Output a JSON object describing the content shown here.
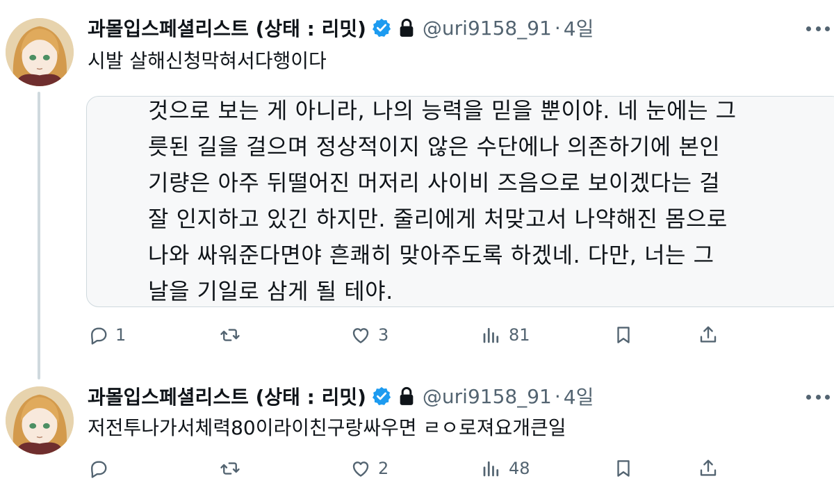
{
  "tweets": [
    {
      "author": {
        "display_name": "과몰입스페셜리스트 (상태 : 리밋)",
        "handle": "@uri9158_91",
        "time": "4일",
        "verified": true,
        "protected": true
      },
      "text": "시발 살해신청막혀서다행이다",
      "quote_lines": [
        "것으로 보는 게 아니라, 나의 능력을 믿을 뿐이야. 네 눈에는 그",
        "릇된 길을 걸으며 정상적이지 않은 수단에나 의존하기에 본인",
        "기량은 아주 뒤떨어진 머저리 사이비 즈음으로 보이겠다는 걸",
        "잘 인지하고 있긴 하지만. 줄리에게 처맞고서 나약해진 몸으로",
        "나와 싸워준다면야 흔쾌히 맞아주도록 하겠네. 다만, 너는 그",
        "날을 기일로 삼게 될 테야."
      ],
      "actions": {
        "reply_count": "1",
        "retweet_count": "",
        "like_count": "3",
        "view_count": "81"
      }
    },
    {
      "author": {
        "display_name": "과몰입스페셜리스트 (상태 : 리밋)",
        "handle": "@uri9158_91",
        "time": "4일",
        "verified": true,
        "protected": true
      },
      "text": "저전투나가서체력80이라이친구랑싸우면 ㄹㅇ로져요개큰일",
      "actions": {
        "reply_count": "",
        "retweet_count": "",
        "like_count": "2",
        "view_count": "48"
      }
    }
  ],
  "icons": {
    "verified": "verified-badge-icon",
    "protected": "lock-icon",
    "more": "more-icon",
    "reply": "reply-icon",
    "retweet": "retweet-icon",
    "like": "like-icon",
    "views": "views-icon",
    "bookmark": "bookmark-icon",
    "share": "share-icon"
  },
  "colors": {
    "verified": "#1d9bf0",
    "secondary_text": "#536471",
    "thread_line": "#cfd9de",
    "quote_background": "#f7f8f9"
  }
}
